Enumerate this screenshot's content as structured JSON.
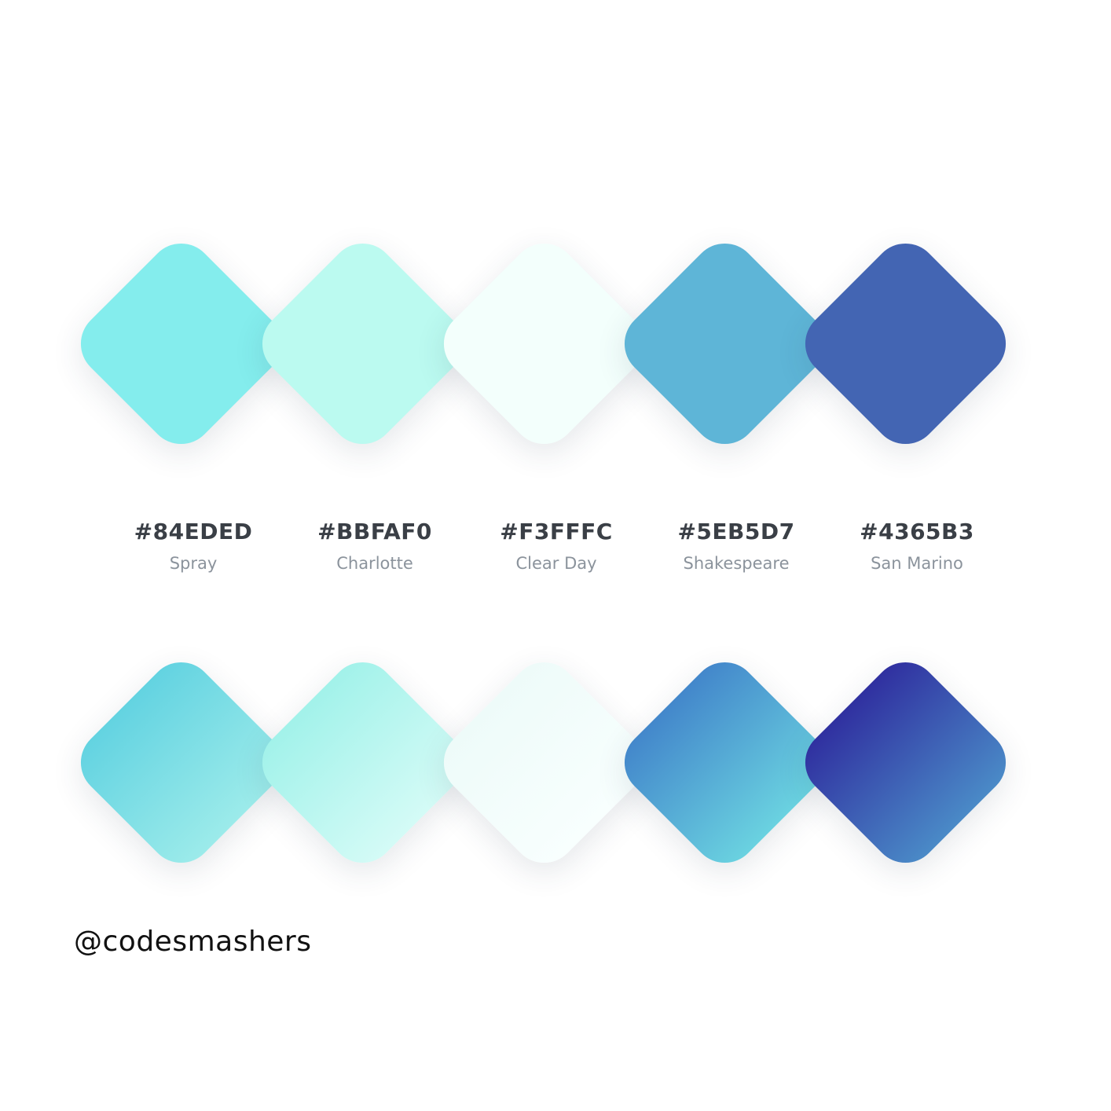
{
  "palette": [
    {
      "hex": "#84EDED",
      "name": "Spray",
      "gradient": [
        "#63D3E1",
        "#9CEBEA"
      ]
    },
    {
      "hex": "#BBFAF0",
      "name": "Charlotte",
      "gradient": [
        "#A2F2EA",
        "#D4FBF6"
      ]
    },
    {
      "hex": "#F3FFFC",
      "name": "Clear Day",
      "gradient": [
        "#EEFBF9",
        "#F8FFFE"
      ]
    },
    {
      "hex": "#5EB5D7",
      "name": "Shakespeare",
      "gradient": [
        "#4387CB",
        "#6AD2E0"
      ]
    },
    {
      "hex": "#4365B3",
      "name": "San Marino",
      "gradient": [
        "#3030A0",
        "#4A8AC7"
      ]
    }
  ],
  "watermark": "@codesmashers"
}
